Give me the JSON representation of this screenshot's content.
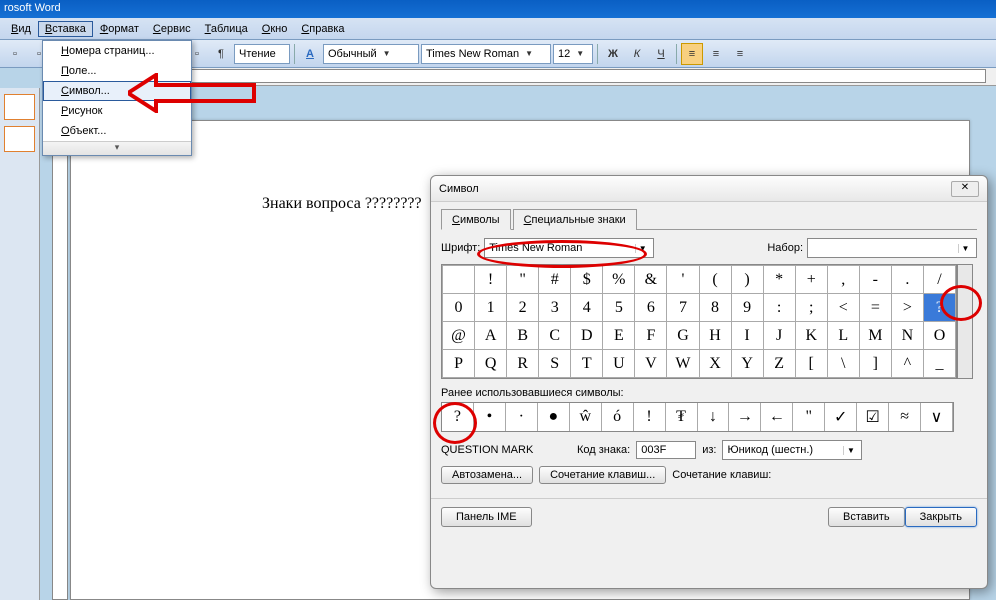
{
  "app_title": "rosoft Word",
  "menubar": {
    "items": [
      "Вид",
      "Вставка",
      "Формат",
      "Сервис",
      "Таблица",
      "Окно",
      "Справка"
    ],
    "underlines": [
      "В",
      "В",
      "Ф",
      "С",
      "Т",
      "О",
      "С"
    ],
    "active_index": 1
  },
  "toolbar": {
    "reading": "Чтение",
    "style": "Обычный",
    "font": "Times New Roman",
    "size": "12",
    "bold": "Ж",
    "italic": "К",
    "underline": "Ч"
  },
  "dropdown": {
    "items": [
      {
        "label": "Номера страниц...",
        "u": "Н"
      },
      {
        "label": "Поле...",
        "u": "П"
      },
      {
        "label": "Символ...",
        "u": "С",
        "hl": true
      },
      {
        "label": "Рисунок",
        "u": "Р"
      },
      {
        "label": "Объект...",
        "u": "О"
      }
    ]
  },
  "doc_text": "Знаки вопроса ????????",
  "dialog": {
    "title": "Символ",
    "tabs": [
      "Символы",
      "Специальные знаки"
    ],
    "tab_underlines": [
      "С",
      "С"
    ],
    "active_tab": 0,
    "font_label": "Шрифт:",
    "font_value": "Times New Roman",
    "subset_label": "Набор:",
    "subset_value": "",
    "grid": [
      [
        " ",
        "!",
        "\"",
        "#",
        "$",
        "%",
        "&",
        "'",
        "(",
        ")",
        "*",
        "+",
        ",",
        "-",
        ".",
        "/"
      ],
      [
        "0",
        "1",
        "2",
        "3",
        "4",
        "5",
        "6",
        "7",
        "8",
        "9",
        ":",
        ";",
        "<",
        "=",
        ">",
        "?"
      ],
      [
        "@",
        "A",
        "B",
        "C",
        "D",
        "E",
        "F",
        "G",
        "H",
        "I",
        "J",
        "K",
        "L",
        "M",
        "N",
        "O"
      ],
      [
        "P",
        "Q",
        "R",
        "S",
        "T",
        "U",
        "V",
        "W",
        "X",
        "Y",
        "Z",
        "[",
        "\\",
        "]",
        "^",
        "_"
      ]
    ],
    "selected_row": 1,
    "selected_col": 15,
    "recent_label": "Ранее использовавшиеся символы:",
    "recent": [
      "?",
      "•",
      "·",
      "●",
      "ŵ",
      "ó",
      "!",
      "₮",
      "↓",
      "→",
      "←",
      "\"",
      "✓",
      "☑",
      "≈",
      "∨"
    ],
    "char_name": "QUESTION MARK",
    "code_label": "Код знака:",
    "code_value": "003F",
    "from_label": "из:",
    "from_value": "Юникод (шестн.)",
    "autocorrect_btn": "Автозамена...",
    "shortcut_btn": "Сочетание клавиш...",
    "shortcut_label": "Сочетание клавиш:",
    "ime_btn": "Панель IME",
    "insert_btn": "Вставить",
    "close_btn": "Закрыть"
  }
}
